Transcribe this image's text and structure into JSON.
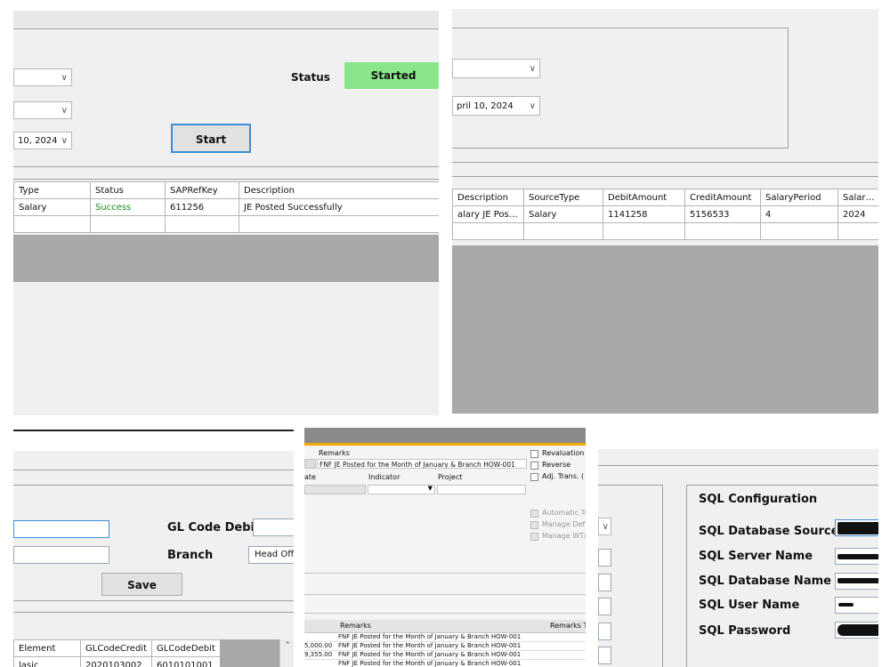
{
  "panel1": {
    "status_label": "Status",
    "status_value": "Started",
    "status_color": "#8ae68a",
    "date_value": "10, 2024",
    "start_button": "Start",
    "columns": [
      "Type",
      "Status",
      "SAPRefKey",
      "Description"
    ],
    "rows": [
      [
        "Salary",
        "Success",
        "611256",
        "JE Posted Successfully"
      ]
    ],
    "success_color": "#1a8a1a"
  },
  "panel2": {
    "date_value": "pril   10, 2024",
    "columns": [
      "Description",
      "SourceType",
      "DebitAmount",
      "CreditAmount",
      "SalaryPeriod",
      "SalaryYe"
    ],
    "rows": [
      [
        "alary JE Posted...",
        "Salary",
        "1141258",
        "5156533",
        "4",
        "2024"
      ]
    ]
  },
  "panel3": {
    "gl_debit_label": "GL Code Debit",
    "branch_label": "Branch",
    "branch_value": "Head Offi",
    "save_button": "Save",
    "columns": [
      "Element",
      "GLCodeCredit",
      "GLCodeDebit"
    ],
    "rows": [
      [
        "lasic",
        "2020103002",
        "6010101001"
      ]
    ]
  },
  "panel4": {
    "remarks_label": "Remarks",
    "remarks_value": "FNF JE Posted for the Month of January & Branch HOW-001",
    "revaluation": "Revaluation",
    "reverse": "Reverse",
    "adj_trans": "Adj. Trans. (",
    "date_col": "ate",
    "indicator_col": "Indicator",
    "project_col": "Project",
    "automatic_tax": "Automatic Ta",
    "manage_def": "Manage Defi",
    "manage_wt": "Manage WT/",
    "grid_remarks_header": "Remarks",
    "grid_remarks_t_header": "Remarks T",
    "grid_rows": [
      {
        "amount": "",
        "remarks": "FNF JE Posted for the Month of January & Branch HOW-001"
      },
      {
        "amount": "5,000.00",
        "remarks": "FNF JE Posted for the Month of January & Branch HOW-001"
      },
      {
        "amount": "9,355.00",
        "remarks": "FNF JE Posted for the Month of January & Branch HOW-001"
      },
      {
        "amount": "",
        "remarks": "FNF JE Posted for the Month of January & Branch HOW-001"
      }
    ],
    "title_bar_color": "#f5a800"
  },
  "panel5": {
    "section_title": "SQL Configuration",
    "labels": [
      "SQL Database Source",
      "SQL Server Name",
      "SQL Database Name",
      "SQL User Name",
      "SQL Password"
    ]
  }
}
